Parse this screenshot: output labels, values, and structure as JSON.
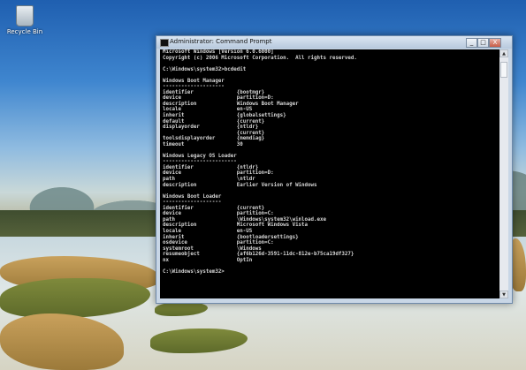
{
  "desktop": {
    "recycle_bin_label": "Recycle Bin"
  },
  "window": {
    "title": "Administrator: Command Prompt",
    "minimize": "_",
    "maximize": "□",
    "close": "X"
  },
  "console_lines": [
    "Microsoft Windows [Version 6.0.6000]",
    "Copyright (c) 2006 Microsoft Corporation.  All rights reserved.",
    "",
    "C:\\Windows\\system32>bcdedit",
    "",
    "Windows Boot Manager",
    "--------------------",
    "identifier              {bootmgr}",
    "device                  partition=D:",
    "description             Windows Boot Manager",
    "locale                  en-US",
    "inherit                 {globalsettings}",
    "default                 {current}",
    "displayorder            {ntldr}",
    "                        {current}",
    "toolsdisplayorder       {memdiag}",
    "timeout                 30",
    "",
    "Windows Legacy OS Loader",
    "------------------------",
    "identifier              {ntldr}",
    "device                  partition=D:",
    "path                    \\ntldr",
    "description             Earlier Version of Windows",
    "",
    "Windows Boot Loader",
    "-------------------",
    "identifier              {current}",
    "device                  partition=C:",
    "path                    \\Windows\\system32\\winload.exe",
    "description             Microsoft Windows Vista",
    "locale                  en-US",
    "inherit                 {bootloadersettings}",
    "osdevice                partition=C:",
    "systemroot              \\Windows",
    "resumeobject            {af6b126d-3591-11dc-812e-b75ca19df327}",
    "nx                      OptIn",
    "",
    "C:\\Windows\\system32>"
  ]
}
